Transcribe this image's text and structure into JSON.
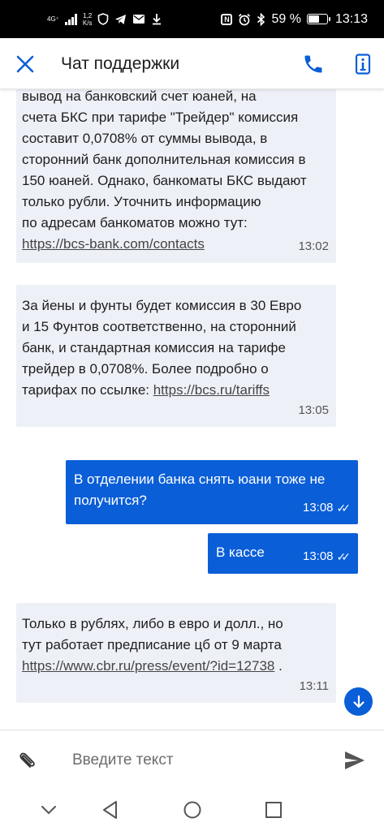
{
  "status_bar": {
    "network": "4G⁺",
    "speed_value": "1,2",
    "speed_unit": "K/s",
    "nfc": "N",
    "battery_percent": "59 %",
    "battery_level": 0.59,
    "time": "13:13"
  },
  "header": {
    "title": "Чат поддержки",
    "icons": [
      "close-icon",
      "phone-icon",
      "info-card-icon"
    ]
  },
  "messages": [
    {
      "direction": "incoming",
      "text": "вывод на банковский счет юаней, на\nсчета БКС при тарифе \"Трейдер\" комиссия\nсоставит 0,0708% от суммы вывода, в\nсторонний банк дополнительная комиссия в\n150 юаней. Однако, банкоматы БКС выдают\nтолько рубли. Уточнить информацию\nпо адресам банкоматов можно тут:",
      "link": "https://bcs-bank.com/contacts",
      "time": "13:02"
    },
    {
      "direction": "incoming",
      "text": "За йены и фунты будет комиссия в 30 Евро\nи 15 Фунтов соответственно, на сторонний\nбанк, и стандартная комиссия на тарифе\nтрейдер в 0,0708%. Более подробно о\nтарифах по ссылке: ",
      "link": "https://bcs.ru/tariffs",
      "time": "13:05"
    },
    {
      "direction": "outgoing",
      "text": "В отделении банка снять юани тоже не\nполучится?",
      "time": "13:08",
      "status": "read"
    },
    {
      "direction": "outgoing",
      "text": "В кассе",
      "time": "13:08",
      "status": "read"
    },
    {
      "direction": "incoming",
      "text": "Только в рублях, либо в евро и долл., но\nтут работает предписание цб от 9 марта",
      "link": "https://www.cbr.ru/press/event/?id=12738",
      "link_suffix": " .",
      "time": "13:11"
    }
  ],
  "input": {
    "placeholder": "Введите текст",
    "value": ""
  },
  "colors": {
    "accent": "#0a5ed7",
    "incoming_bubble": "#eef0f8",
    "status_bar": "#000000"
  }
}
